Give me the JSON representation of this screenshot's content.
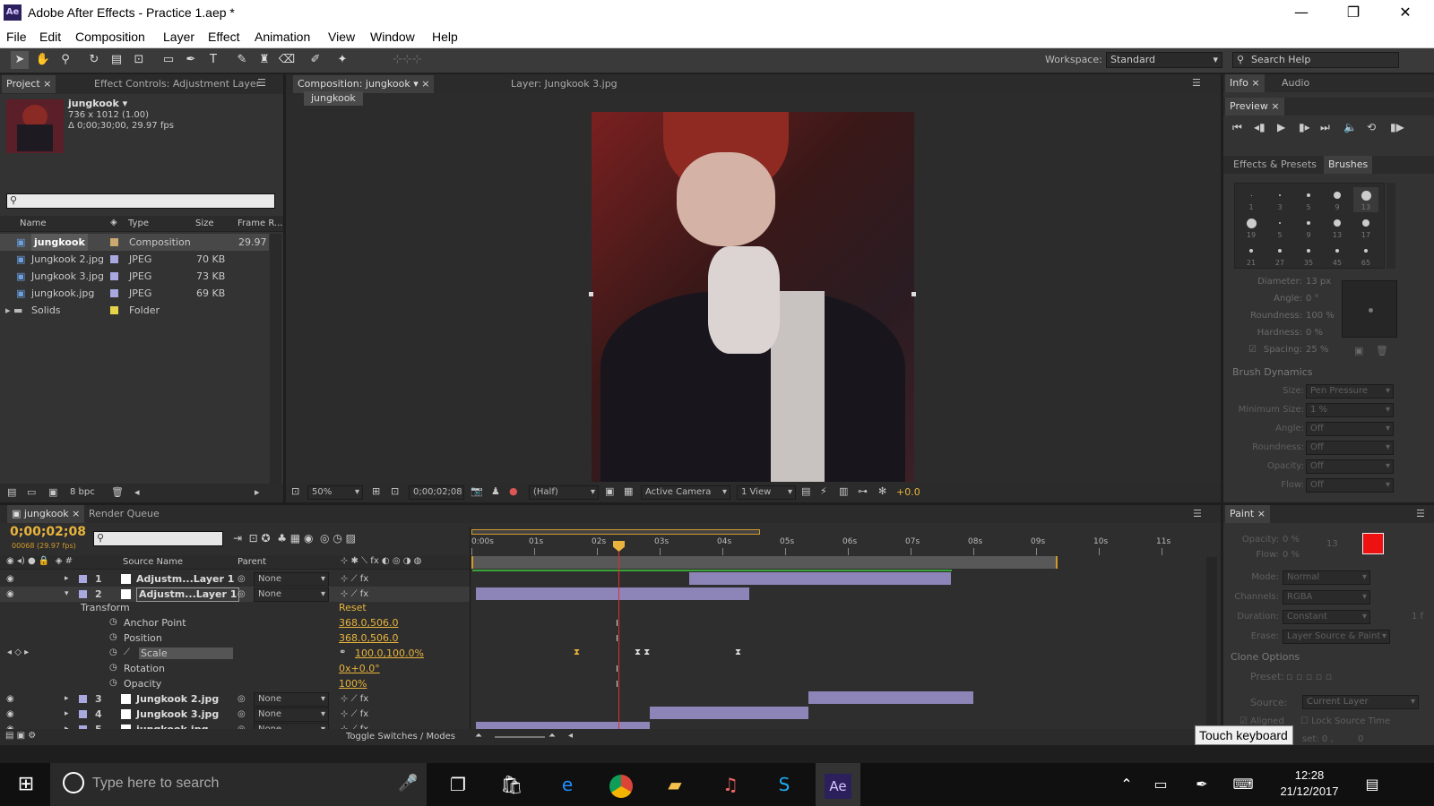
{
  "window": {
    "title": "Adobe After Effects - Practice 1.aep *",
    "logo": "Ae",
    "minimize": "—",
    "maximize": "❐",
    "close": "✕"
  },
  "menu": [
    "File",
    "Edit",
    "Composition",
    "Layer",
    "Effect",
    "Animation",
    "View",
    "Window",
    "Help"
  ],
  "toolbar": {
    "workspace_label": "Workspace:",
    "workspace_value": "Standard",
    "search_placeholder": "Search Help"
  },
  "project": {
    "tab_project": "Project",
    "tab_effect_controls": "Effect Controls: Adjustment Layer",
    "selected_name": "jungkook ▾",
    "selected_dims": "736 x 1012 (1.00)",
    "selected_dur": "Δ 0;00;30;00, 29.97 fps",
    "columns": {
      "name": "Name",
      "type": "Type",
      "size": "Size",
      "frame_rate": "Frame R..."
    },
    "items": [
      {
        "name": "jungkook",
        "type": "Composition",
        "size": "",
        "fr": "29.97",
        "color": "#c9a96e"
      },
      {
        "name": "Jungkook 2.jpg",
        "type": "JPEG",
        "size": "70 KB",
        "fr": "",
        "color": "#a9a9e0"
      },
      {
        "name": "Jungkook 3.jpg",
        "type": "JPEG",
        "size": "73 KB",
        "fr": "",
        "color": "#a9a9e0"
      },
      {
        "name": "jungkook.jpg",
        "type": "JPEG",
        "size": "69 KB",
        "fr": "",
        "color": "#a9a9e0"
      },
      {
        "name": "Solids",
        "type": "Folder",
        "size": "",
        "fr": "",
        "color": "#e5d44a"
      }
    ],
    "bpc": "8 bpc"
  },
  "composition": {
    "tab_comp": "Composition: jungkook",
    "tab_layer": "Layer: Jungkook 3.jpg",
    "breadcrumb": "jungkook",
    "zoom": "50%",
    "timecode": "0;00;02;08",
    "resolution": "(Half)",
    "camera": "Active Camera",
    "views": "1 View",
    "exposure": "+0.0"
  },
  "right": {
    "tab_info": "Info",
    "tab_audio": "Audio",
    "tab_preview": "Preview",
    "tab_effects": "Effects & Presets",
    "tab_brushes": "Brushes",
    "brush_sizes": [
      "1",
      "3",
      "5",
      "9",
      "13",
      "19",
      "5",
      "9",
      "13",
      "17",
      "21",
      "27",
      "35",
      "45",
      "65"
    ],
    "brush_props": [
      {
        "label": "Diameter:",
        "value": "13 px"
      },
      {
        "label": "Angle:",
        "value": "0 °"
      },
      {
        "label": "Roundness:",
        "value": "100 %"
      },
      {
        "label": "Hardness:",
        "value": "0 %"
      },
      {
        "label": "Spacing:",
        "value": "25 %"
      }
    ],
    "dynamics_title": "Brush Dynamics",
    "dynamics": [
      {
        "label": "Size:",
        "value": "Pen Pressure"
      },
      {
        "label": "Minimum Size:",
        "value": "1 %"
      },
      {
        "label": "Angle:",
        "value": "Off"
      },
      {
        "label": "Roundness:",
        "value": "Off"
      },
      {
        "label": "Opacity:",
        "value": "Off"
      },
      {
        "label": "Flow:",
        "value": "Off"
      }
    ],
    "tab_paint": "Paint",
    "paint": [
      {
        "label": "Opacity:",
        "value": "0 %"
      },
      {
        "label": "Flow:",
        "value": "0 %"
      },
      {
        "label": "Mode:",
        "value": "Normal"
      },
      {
        "label": "Channels:",
        "value": "RGBA"
      },
      {
        "label": "Duration:",
        "value": "Constant"
      },
      {
        "label": "Erase:",
        "value": "Layer Source & Paint"
      }
    ],
    "paint_num": "13",
    "duration_extra": "1  f",
    "clone_title": "Clone Options",
    "preset_label": "Preset:",
    "source_label": "Source:",
    "source_value": "Current Layer",
    "aligned": "Aligned",
    "lock_source": "Lock Source Time",
    "offset": "set: 0 ,",
    "offset_val": "0",
    "fg_color": "#ee1111",
    "tooltip": "Touch keyboard"
  },
  "timeline": {
    "tab_comp": "jungkook",
    "tab_render": "Render Queue",
    "timecode": "0;00;02;08",
    "frame_info": "00068 (29.97 fps)",
    "col_source": "Source Name",
    "col_parent": "Parent",
    "ruler": [
      "0:00s",
      "01s",
      "02s",
      "03s",
      "04s",
      "05s",
      "06s",
      "07s",
      "08s",
      "09s",
      "10s",
      "11s"
    ],
    "layers": [
      {
        "num": "1",
        "name": "Adjustm...Layer 1",
        "parent": "None"
      },
      {
        "num": "2",
        "name": "Adjustm...Layer 1",
        "parent": "None"
      }
    ],
    "transform": "Transform",
    "reset": "Reset",
    "props": [
      {
        "name": "Anchor Point",
        "value": "368.0,506.0"
      },
      {
        "name": "Position",
        "value": "368.0,506.0"
      },
      {
        "name": "Scale",
        "value": "100.0,100.0%"
      },
      {
        "name": "Rotation",
        "value": "0x+0.0°"
      },
      {
        "name": "Opacity",
        "value": "100%"
      }
    ],
    "layers_lower": [
      {
        "num": "3",
        "name": "Jungkook 2.jpg",
        "parent": "None"
      },
      {
        "num": "4",
        "name": "Jungkook 3.jpg",
        "parent": "None"
      },
      {
        "num": "5",
        "name": "jungkook.jpg",
        "parent": "None"
      }
    ],
    "toggle": "Toggle Switches / Modes"
  },
  "taskbar": {
    "search_placeholder": "Type here to search",
    "time": "12:28",
    "date": "21/12/2017",
    "ae_label": "Ae"
  }
}
